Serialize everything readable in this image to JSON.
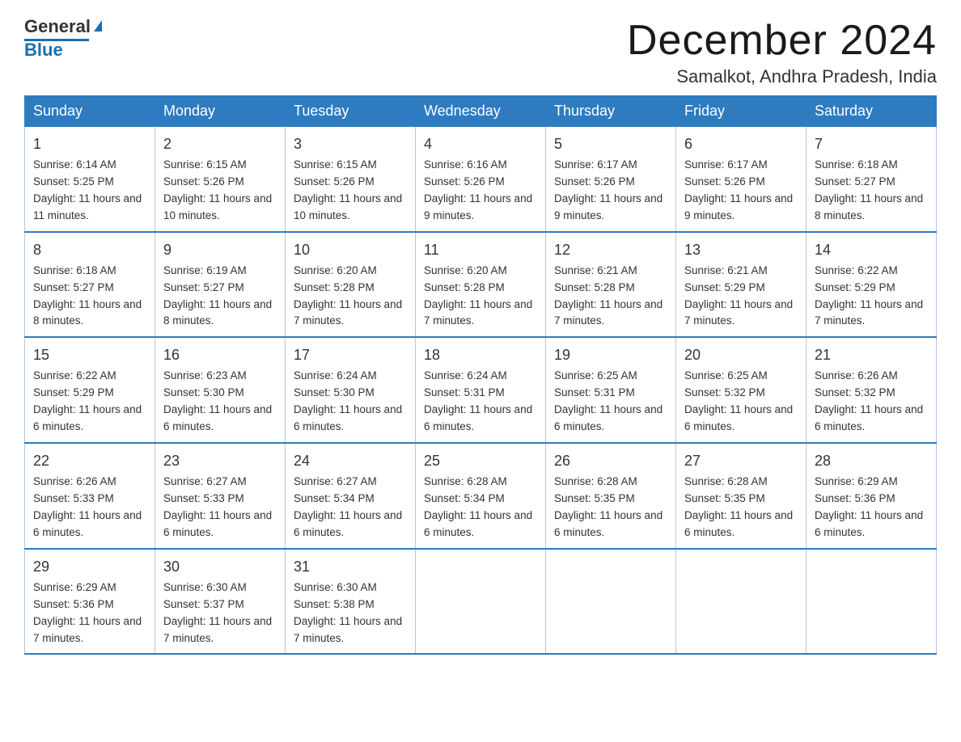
{
  "logo": {
    "general": "General",
    "blue": "Blue"
  },
  "title": "December 2024",
  "location": "Samalkot, Andhra Pradesh, India",
  "weekdays": [
    "Sunday",
    "Monday",
    "Tuesday",
    "Wednesday",
    "Thursday",
    "Friday",
    "Saturday"
  ],
  "weeks": [
    [
      {
        "day": "1",
        "sunrise": "6:14 AM",
        "sunset": "5:25 PM",
        "daylight": "11 hours and 11 minutes."
      },
      {
        "day": "2",
        "sunrise": "6:15 AM",
        "sunset": "5:26 PM",
        "daylight": "11 hours and 10 minutes."
      },
      {
        "day": "3",
        "sunrise": "6:15 AM",
        "sunset": "5:26 PM",
        "daylight": "11 hours and 10 minutes."
      },
      {
        "day": "4",
        "sunrise": "6:16 AM",
        "sunset": "5:26 PM",
        "daylight": "11 hours and 9 minutes."
      },
      {
        "day": "5",
        "sunrise": "6:17 AM",
        "sunset": "5:26 PM",
        "daylight": "11 hours and 9 minutes."
      },
      {
        "day": "6",
        "sunrise": "6:17 AM",
        "sunset": "5:26 PM",
        "daylight": "11 hours and 9 minutes."
      },
      {
        "day": "7",
        "sunrise": "6:18 AM",
        "sunset": "5:27 PM",
        "daylight": "11 hours and 8 minutes."
      }
    ],
    [
      {
        "day": "8",
        "sunrise": "6:18 AM",
        "sunset": "5:27 PM",
        "daylight": "11 hours and 8 minutes."
      },
      {
        "day": "9",
        "sunrise": "6:19 AM",
        "sunset": "5:27 PM",
        "daylight": "11 hours and 8 minutes."
      },
      {
        "day": "10",
        "sunrise": "6:20 AM",
        "sunset": "5:28 PM",
        "daylight": "11 hours and 7 minutes."
      },
      {
        "day": "11",
        "sunrise": "6:20 AM",
        "sunset": "5:28 PM",
        "daylight": "11 hours and 7 minutes."
      },
      {
        "day": "12",
        "sunrise": "6:21 AM",
        "sunset": "5:28 PM",
        "daylight": "11 hours and 7 minutes."
      },
      {
        "day": "13",
        "sunrise": "6:21 AM",
        "sunset": "5:29 PM",
        "daylight": "11 hours and 7 minutes."
      },
      {
        "day": "14",
        "sunrise": "6:22 AM",
        "sunset": "5:29 PM",
        "daylight": "11 hours and 7 minutes."
      }
    ],
    [
      {
        "day": "15",
        "sunrise": "6:22 AM",
        "sunset": "5:29 PM",
        "daylight": "11 hours and 6 minutes."
      },
      {
        "day": "16",
        "sunrise": "6:23 AM",
        "sunset": "5:30 PM",
        "daylight": "11 hours and 6 minutes."
      },
      {
        "day": "17",
        "sunrise": "6:24 AM",
        "sunset": "5:30 PM",
        "daylight": "11 hours and 6 minutes."
      },
      {
        "day": "18",
        "sunrise": "6:24 AM",
        "sunset": "5:31 PM",
        "daylight": "11 hours and 6 minutes."
      },
      {
        "day": "19",
        "sunrise": "6:25 AM",
        "sunset": "5:31 PM",
        "daylight": "11 hours and 6 minutes."
      },
      {
        "day": "20",
        "sunrise": "6:25 AM",
        "sunset": "5:32 PM",
        "daylight": "11 hours and 6 minutes."
      },
      {
        "day": "21",
        "sunrise": "6:26 AM",
        "sunset": "5:32 PM",
        "daylight": "11 hours and 6 minutes."
      }
    ],
    [
      {
        "day": "22",
        "sunrise": "6:26 AM",
        "sunset": "5:33 PM",
        "daylight": "11 hours and 6 minutes."
      },
      {
        "day": "23",
        "sunrise": "6:27 AM",
        "sunset": "5:33 PM",
        "daylight": "11 hours and 6 minutes."
      },
      {
        "day": "24",
        "sunrise": "6:27 AM",
        "sunset": "5:34 PM",
        "daylight": "11 hours and 6 minutes."
      },
      {
        "day": "25",
        "sunrise": "6:28 AM",
        "sunset": "5:34 PM",
        "daylight": "11 hours and 6 minutes."
      },
      {
        "day": "26",
        "sunrise": "6:28 AM",
        "sunset": "5:35 PM",
        "daylight": "11 hours and 6 minutes."
      },
      {
        "day": "27",
        "sunrise": "6:28 AM",
        "sunset": "5:35 PM",
        "daylight": "11 hours and 6 minutes."
      },
      {
        "day": "28",
        "sunrise": "6:29 AM",
        "sunset": "5:36 PM",
        "daylight": "11 hours and 6 minutes."
      }
    ],
    [
      {
        "day": "29",
        "sunrise": "6:29 AM",
        "sunset": "5:36 PM",
        "daylight": "11 hours and 7 minutes."
      },
      {
        "day": "30",
        "sunrise": "6:30 AM",
        "sunset": "5:37 PM",
        "daylight": "11 hours and 7 minutes."
      },
      {
        "day": "31",
        "sunrise": "6:30 AM",
        "sunset": "5:38 PM",
        "daylight": "11 hours and 7 minutes."
      },
      null,
      null,
      null,
      null
    ]
  ]
}
